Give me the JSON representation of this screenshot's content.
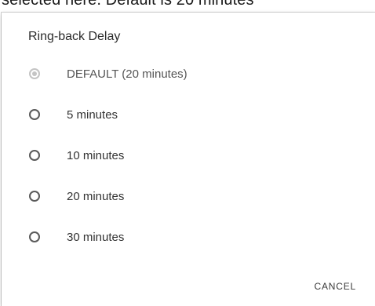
{
  "background": {
    "caption": "selected here. Default is 20 minutes"
  },
  "dialog": {
    "title": "Ring-back Delay",
    "options": [
      {
        "label": "DEFAULT (20 minutes)",
        "selected": true,
        "disabled": true
      },
      {
        "label": "5 minutes",
        "selected": false,
        "disabled": false
      },
      {
        "label": "10 minutes",
        "selected": false,
        "disabled": false
      },
      {
        "label": "20 minutes",
        "selected": false,
        "disabled": false
      },
      {
        "label": "30 minutes",
        "selected": false,
        "disabled": false
      }
    ],
    "cancel_label": "CANCEL"
  },
  "colors": {
    "radio_border": "#5a5a5a",
    "radio_disabled": "#c4c4c4",
    "text": "#333333"
  }
}
